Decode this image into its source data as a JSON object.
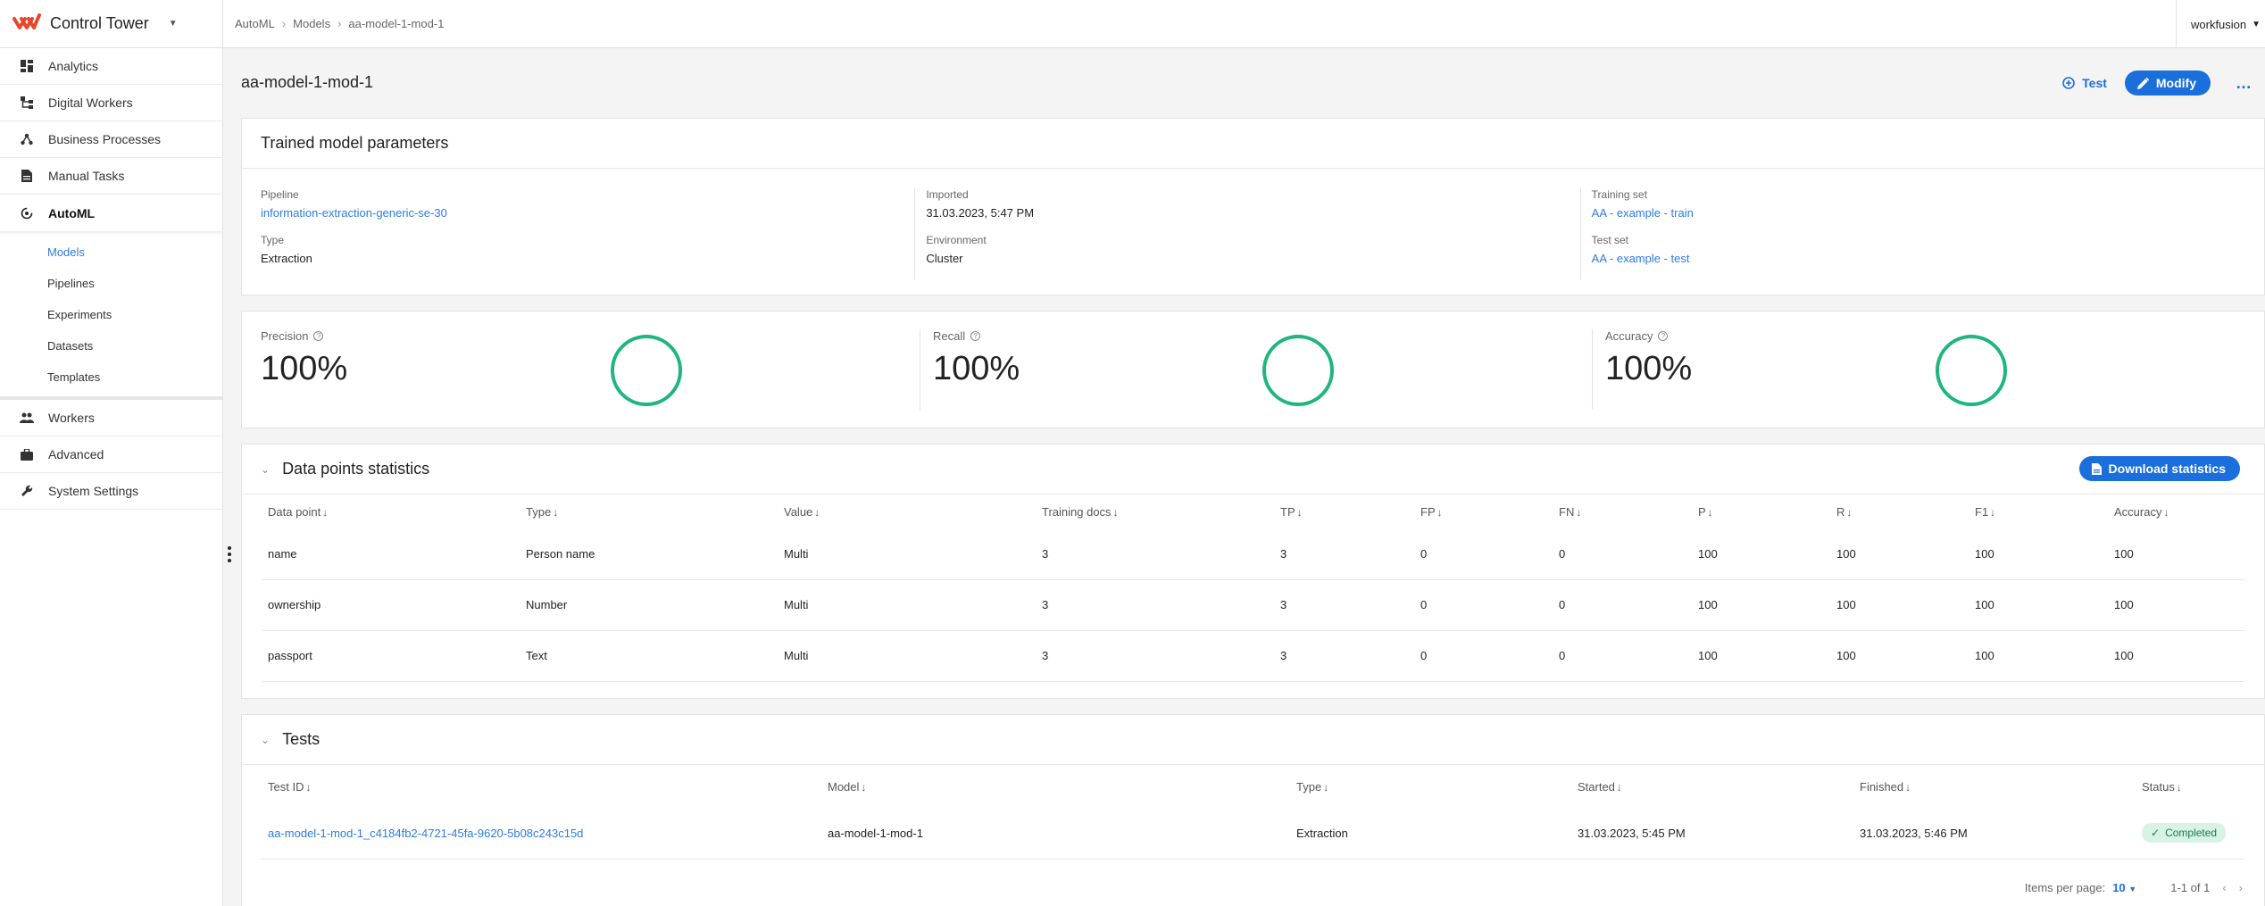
{
  "app": {
    "name": "Control Tower",
    "tenant": "workfusion"
  },
  "sidebar": {
    "items": [
      {
        "label": "Analytics",
        "icon": "dashboard-icon"
      },
      {
        "label": "Digital Workers",
        "icon": "hierarchy-icon"
      },
      {
        "label": "Business Processes",
        "icon": "process-icon"
      },
      {
        "label": "Manual Tasks",
        "icon": "document-icon"
      },
      {
        "label": "AutoML",
        "icon": "automl-icon"
      }
    ],
    "automl_sub": [
      "Models",
      "Pipelines",
      "Experiments",
      "Datasets",
      "Templates"
    ],
    "bottom_items": [
      {
        "label": "Workers",
        "icon": "people-icon"
      },
      {
        "label": "Advanced",
        "icon": "briefcase-icon"
      },
      {
        "label": "System Settings",
        "icon": "wrench-icon"
      }
    ]
  },
  "breadcrumb": [
    "AutoML",
    "Models",
    "aa-model-1-mod-1"
  ],
  "page": {
    "title": "aa-model-1-mod-1",
    "test_label": "Test",
    "modify_label": "Modify",
    "more_label": "…"
  },
  "params": {
    "title": "Trained model parameters",
    "pipeline_label": "Pipeline",
    "pipeline_value": "information-extraction-generic-se-30",
    "type_label": "Type",
    "type_value": "Extraction",
    "imported_label": "Imported",
    "imported_value": "31.03.2023, 5:47 PM",
    "environment_label": "Environment",
    "environment_value": "Cluster",
    "training_label": "Training set",
    "training_value": "AA - example - train",
    "testset_label": "Test set",
    "testset_value": "AA - example - test"
  },
  "metrics": [
    {
      "label": "Precision",
      "value": "100%",
      "fraction": 1.0
    },
    {
      "label": "Recall",
      "value": "100%",
      "fraction": 1.0
    },
    {
      "label": "Accuracy",
      "value": "100%",
      "fraction": 1.0
    }
  ],
  "stats": {
    "title": "Data points statistics",
    "download_label": "Download statistics",
    "columns": [
      "Data point",
      "Type",
      "Value",
      "Training docs",
      "TP",
      "FP",
      "FN",
      "P",
      "R",
      "F1",
      "Accuracy"
    ],
    "rows": [
      [
        "name",
        "Person name",
        "Multi",
        "3",
        "3",
        "0",
        "0",
        "100",
        "100",
        "100",
        "100"
      ],
      [
        "ownership",
        "Number",
        "Multi",
        "3",
        "3",
        "0",
        "0",
        "100",
        "100",
        "100",
        "100"
      ],
      [
        "passport",
        "Text",
        "Multi",
        "3",
        "3",
        "0",
        "0",
        "100",
        "100",
        "100",
        "100"
      ]
    ]
  },
  "tests": {
    "title": "Tests",
    "columns": [
      "Test ID",
      "Model",
      "Type",
      "Started",
      "Finished",
      "Status"
    ],
    "rows": [
      {
        "id": "aa-model-1-mod-1_c4184fb2-4721-45fa-9620-5b08c243c15d",
        "model": "aa-model-1-mod-1",
        "type": "Extraction",
        "started": "31.03.2023, 5:45 PM",
        "finished": "31.03.2023, 5:46 PM",
        "status": "Completed"
      }
    ],
    "items_per_page_label": "Items per page:",
    "items_per_page": "10",
    "range": "1-1 of 1"
  },
  "colors": {
    "accent": "#1a6fdc",
    "ring": "#1fb57e",
    "brand": "#e8472b"
  }
}
